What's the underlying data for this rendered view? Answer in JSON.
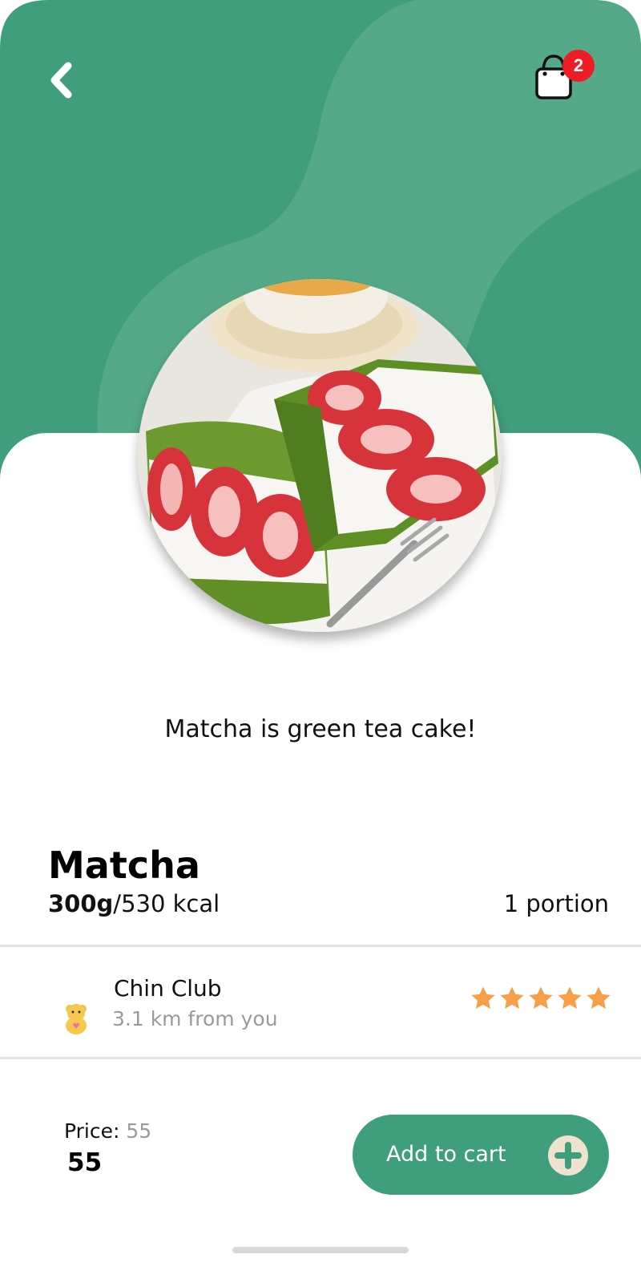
{
  "header": {
    "back_icon": "chevron-left-icon",
    "cart_icon": "shopping-bag-icon",
    "cart_badge_count": "2",
    "colors": {
      "primary_green": "#409e7c",
      "light_green": "#56a988",
      "badge_red": "#ee1d23"
    }
  },
  "product": {
    "image_description_icon": "matcha-strawberry-sandwich-image",
    "tagline": "Matcha is green tea  cake!",
    "name": "Matcha",
    "weight": "300g",
    "calories": "/530 kcal",
    "portion": "1 portion"
  },
  "store": {
    "icon": "bear-icon",
    "name": "Chin Club",
    "distance": "3.1 km from you",
    "rating": 5,
    "rating_max": 5,
    "star_color": "#f7a04a"
  },
  "pricing": {
    "label": "Price: ",
    "old_price": "55",
    "price": "55"
  },
  "actions": {
    "add_to_cart_label": "Add to cart",
    "add_icon": "plus-circle-icon",
    "button_color": "#3f9e7b"
  }
}
